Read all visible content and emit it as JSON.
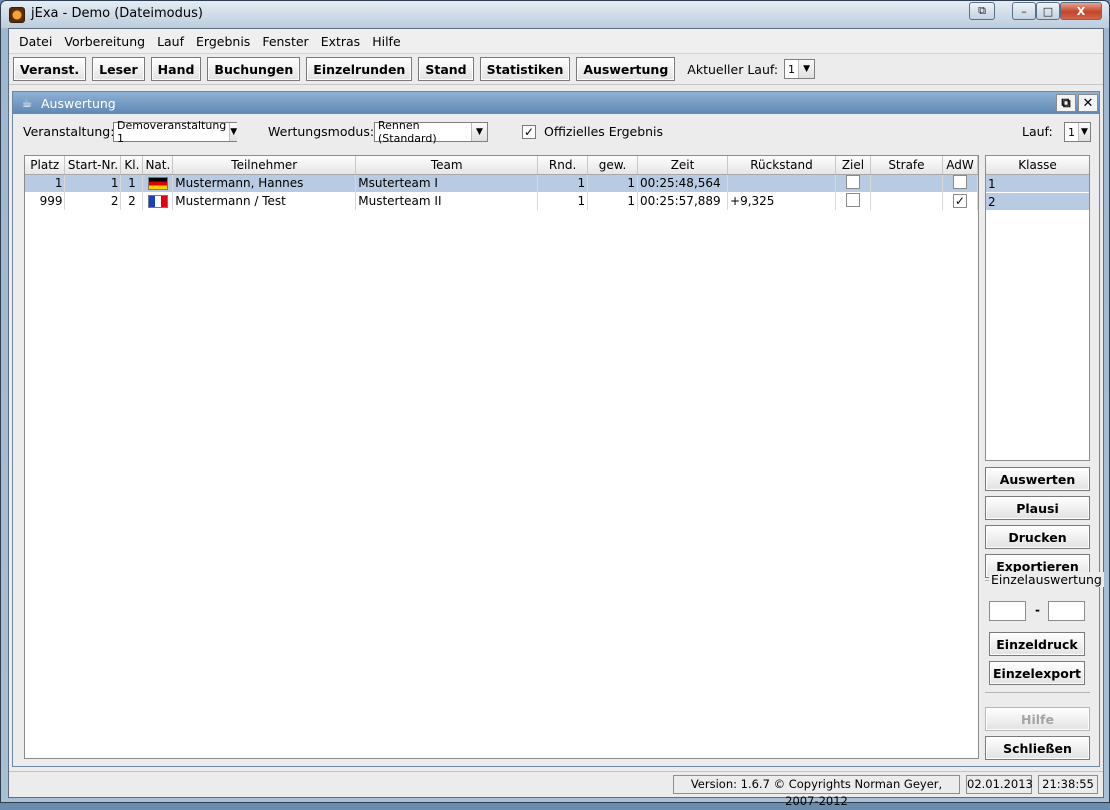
{
  "window": {
    "title": "jExa - Demo (Dateimodus)",
    "controls": {
      "restore": "⧉",
      "minimize": "–",
      "maximize": "□",
      "close": "X"
    }
  },
  "menu": [
    "Datei",
    "Vorbereitung",
    "Lauf",
    "Ergebnis",
    "Fenster",
    "Extras",
    "Hilfe"
  ],
  "toolbar": {
    "buttons": [
      "Veranst.",
      "Leser",
      "Hand",
      "Buchungen",
      "Einzelrunden",
      "Stand",
      "Statistiken",
      "Auswertung"
    ],
    "current_run_label": "Aktueller Lauf:",
    "current_run_value": "1"
  },
  "panel": {
    "title": "Auswertung",
    "event_label": "Veranstaltung:",
    "event_value": "Demoveranstaltung 1",
    "mode_label": "Wertungsmodus:",
    "mode_value": "Rennen (Standard)",
    "official_label": "Offizielles Ergebnis",
    "official_checked": true,
    "run_label": "Lauf:",
    "run_value": "1"
  },
  "table": {
    "columns": [
      "Platz",
      "Start-Nr.",
      "Kl.",
      "Nat.",
      "Teilnehmer",
      "Team",
      "Rnd.",
      "gew.",
      "Zeit",
      "Rückstand",
      "Ziel",
      "Strafe",
      "AdW"
    ],
    "rows": [
      {
        "platz": "1",
        "startnr": "1",
        "kl": "1",
        "nat": "DE",
        "teilnehmer": "Mustermann, Hannes",
        "team": "Msuterteam I",
        "rnd": "1",
        "gew": "1",
        "zeit": "00:25:48,564",
        "rueckstand": "",
        "ziel": false,
        "strafe": "",
        "adw": false
      },
      {
        "platz": "999",
        "startnr": "2",
        "kl": "2",
        "nat": "FR",
        "teilnehmer": "Mustermann / Test",
        "team": "Musterteam II",
        "rnd": "1",
        "gew": "1",
        "zeit": "00:25:57,889",
        "rueckstand": "+9,325",
        "ziel": false,
        "strafe": "",
        "adw": true
      }
    ]
  },
  "classes": {
    "header": "Klasse",
    "items": [
      "1",
      "2"
    ]
  },
  "side_buttons": {
    "auswerten": "Auswerten",
    "plausi": "Plausi",
    "drucken": "Drucken",
    "exportieren": "Exportieren",
    "hilfe": "Hilfe",
    "schliessen": "Schließen"
  },
  "single_eval": {
    "label": "Einzelauswertung",
    "separator": "-",
    "from_value": "",
    "to_value": "",
    "print": "Einzeldruck",
    "export": "Einzelexport"
  },
  "status": {
    "version": "Version: 1.6.7    © Copyrights Norman Geyer, 2007-2012",
    "date": "02.01.2013",
    "time": "21:38:55"
  }
}
